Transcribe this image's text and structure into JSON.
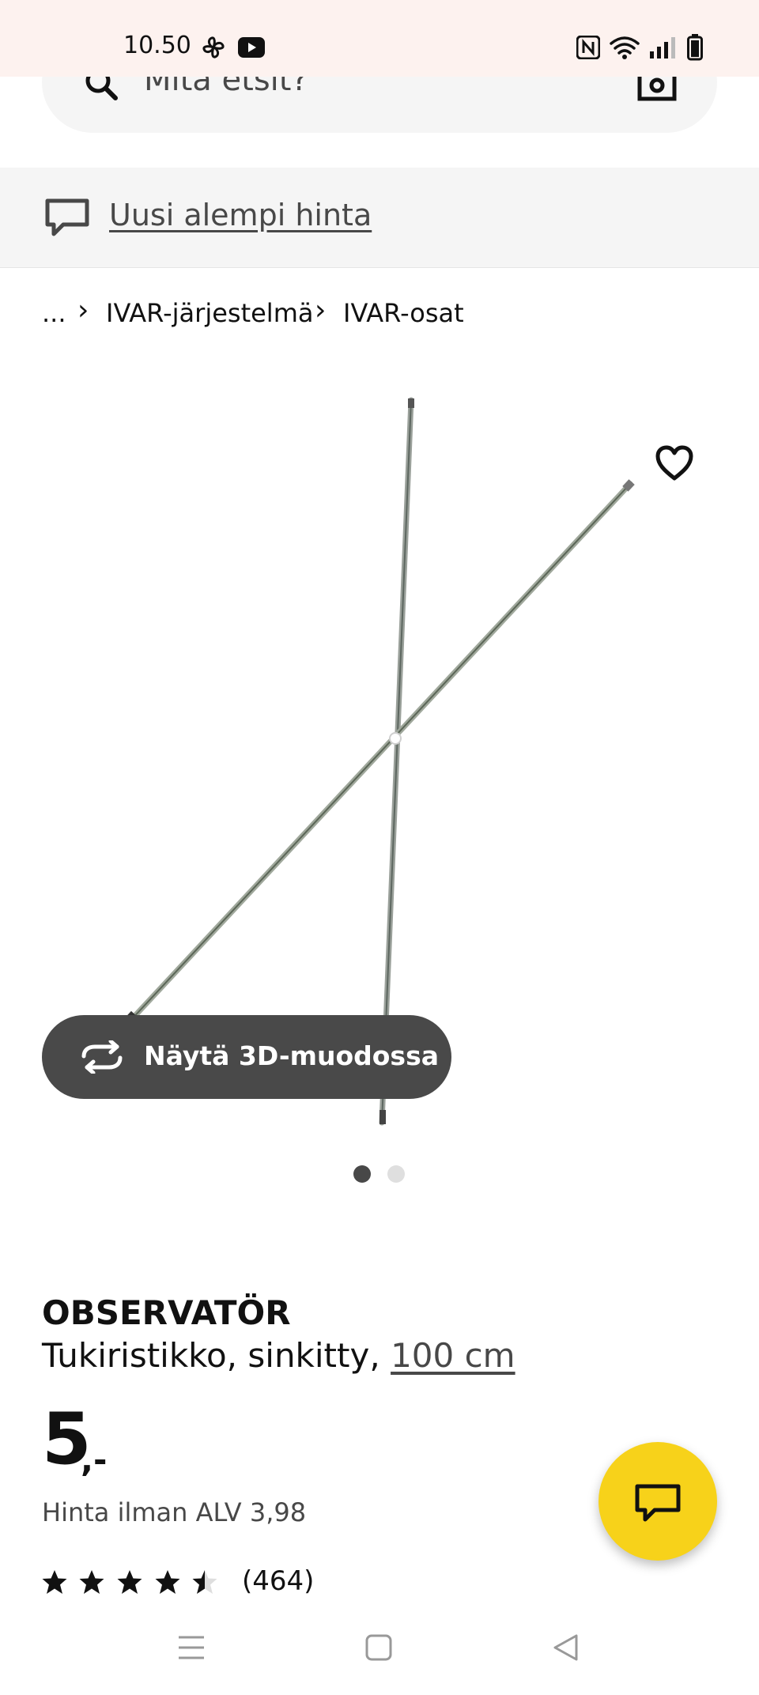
{
  "status_bar": {
    "time": "10.50",
    "icons": [
      "fan-icon",
      "youtube-icon",
      "nfc-icon",
      "wifi-icon",
      "signal-icon",
      "battery-icon"
    ]
  },
  "search": {
    "placeholder": "Mitä etsit?",
    "icons": [
      "search-icon",
      "camera-icon"
    ]
  },
  "notice": {
    "icon": "chat-bubble-icon",
    "text": "Uusi alempi hinta"
  },
  "breadcrumb": {
    "ellipsis": "...",
    "items": [
      "IVAR-järjestelmä",
      "IVAR-osat"
    ],
    "separator_icon": "chevron-right-icon"
  },
  "gallery": {
    "favorite_icon": "heart-icon",
    "view_3d_label": "Näytä 3D-muodossa",
    "view_3d_icon": "rotate-icon",
    "image_count": 2,
    "active_index": 0
  },
  "product": {
    "name": "OBSERVATÖR",
    "description": "Tukiristikko, sinkitty,",
    "size": "100 cm",
    "price": "5",
    "price_suffix": ",-",
    "price_ex_vat": "Hinta ilman ALV 3,98",
    "rating": 4.5,
    "rating_max": 5,
    "review_count": "(464)"
  },
  "chat": {
    "icon": "chat-icon"
  },
  "nav_bar": {
    "icons": [
      "menu-icon",
      "home-icon",
      "back-icon"
    ]
  },
  "colors": {
    "status_bar_bg": "#fdf2ef",
    "surface": "#f5f5f5",
    "button_dark": "#494949",
    "accent_yellow": "#f7d21a",
    "text": "#111111",
    "text_muted": "#484848"
  }
}
